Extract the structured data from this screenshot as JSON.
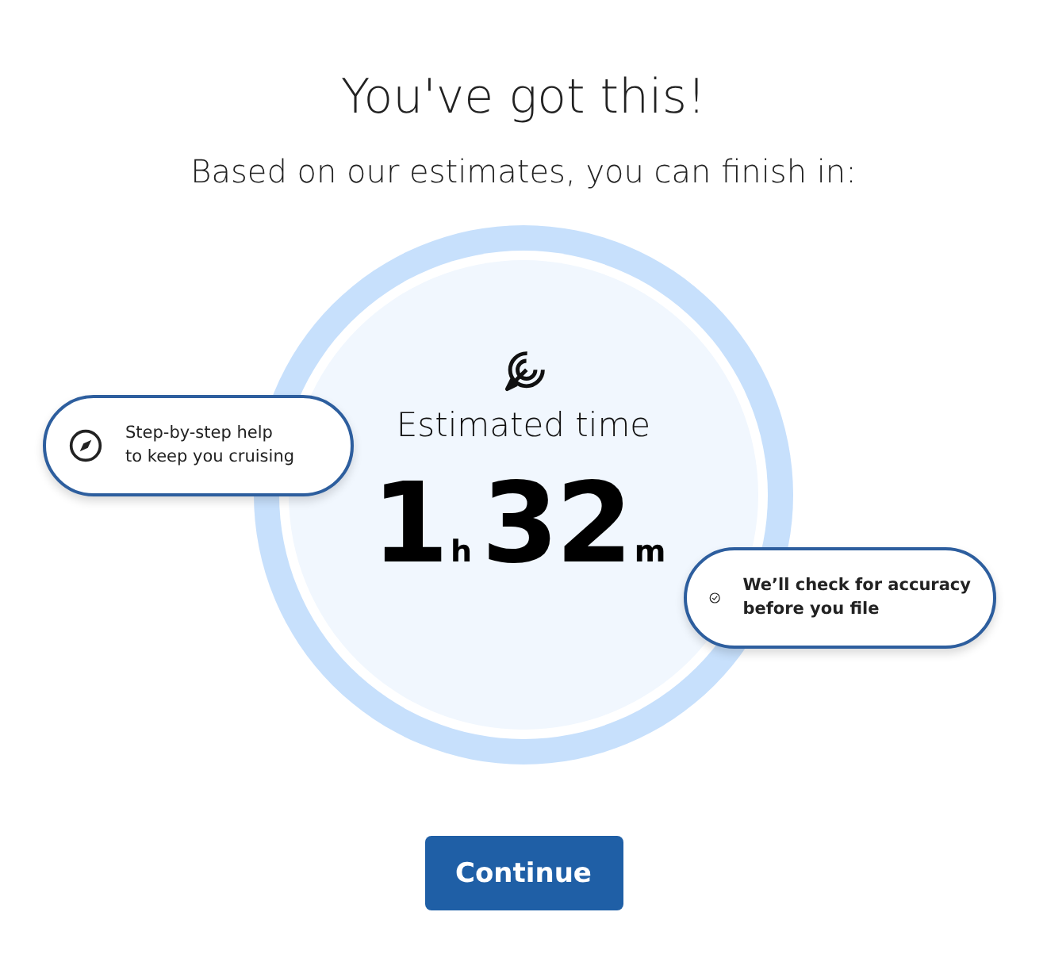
{
  "title": "You've got this!",
  "subtitle": "Based on our estimates, you can finish in:",
  "estimate": {
    "label": "Estimated time",
    "parts": [
      {
        "value": "1",
        "unit": "h"
      },
      {
        "value": "32",
        "unit": "m"
      }
    ]
  },
  "callouts": [
    {
      "kind": "compass",
      "lines": [
        "Step-by-step help",
        "to keep you cruising"
      ]
    },
    {
      "kind": "check",
      "lines": [
        "We’ll check for accuracy",
        "before you file"
      ]
    }
  ],
  "button": "Continue"
}
